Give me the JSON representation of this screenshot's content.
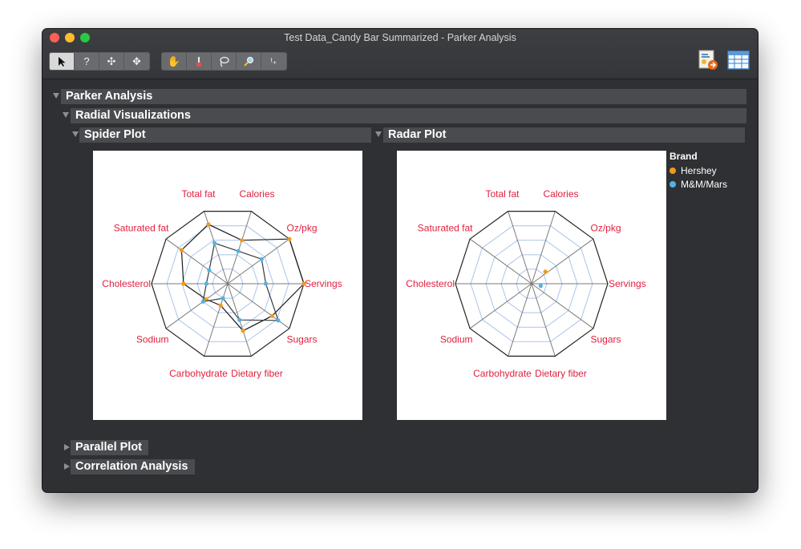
{
  "window": {
    "title": "Test Data_Candy Bar Summarized - Parker Analysis"
  },
  "toolbar": {
    "tools": [
      {
        "name": "arrow-tool",
        "icon": "arrow-icon",
        "glyph": ""
      },
      {
        "name": "help-tool",
        "icon": "question-icon",
        "glyph": "?"
      },
      {
        "name": "selection-tool",
        "icon": "crosshair-icon",
        "glyph": "✣"
      },
      {
        "name": "scroller-tool",
        "icon": "move-icon",
        "glyph": "✥"
      },
      {
        "name": "grabber-tool",
        "icon": "hand-icon",
        "glyph": "✋"
      },
      {
        "name": "brush-tool",
        "icon": "brush-icon",
        "glyph": "♜"
      },
      {
        "name": "lasso-tool",
        "icon": "lasso-icon",
        "glyph": "ρ"
      },
      {
        "name": "magnifier-tool",
        "icon": "magnifier-icon",
        "glyph": "⚲"
      },
      {
        "name": "annotate-tool",
        "icon": "annotate-icon",
        "glyph": "ᵗ₊"
      }
    ]
  },
  "outline": {
    "parker_analysis": "Parker Analysis",
    "radial_visualizations": "Radial Visualizations",
    "spider_plot": "Spider Plot",
    "radar_plot": "Radar Plot",
    "parallel_plot": "Parallel Plot",
    "correlation_analysis": "Correlation Analysis"
  },
  "legend": {
    "title": "Brand",
    "items": [
      {
        "label": "Hershey",
        "color": "#f29a19"
      },
      {
        "label": "M&M/Mars",
        "color": "#52b2e5"
      }
    ]
  },
  "colors": {
    "axis_label": "#e0203e",
    "grid": "#aac4ea",
    "hershey": "#f29a19",
    "mm_mars": "#52b2e5"
  },
  "chart_data": [
    {
      "type": "radar",
      "title": "Spider Plot",
      "axes": [
        "Calories",
        "Oz/pkg",
        "Servings",
        "Sugars",
        "Dietary fiber",
        "Carbohydrate",
        "Sodium",
        "Cholesterol",
        "Saturated fat",
        "Total fat"
      ],
      "series": [
        {
          "name": "Hershey",
          "values": [
            0.6,
            1.0,
            1.0,
            0.72,
            0.65,
            0.3,
            0.35,
            0.58,
            0.75,
            0.82
          ]
        },
        {
          "name": "M&M/Mars",
          "values": [
            0.45,
            0.55,
            0.5,
            0.82,
            0.5,
            0.2,
            0.4,
            0.28,
            0.3,
            0.56
          ]
        }
      ]
    },
    {
      "type": "radar",
      "title": "Radar Plot",
      "axes": [
        "Calories",
        "Oz/pkg",
        "Servings",
        "Sugars",
        "Dietary fiber",
        "Carbohydrate",
        "Sodium",
        "Cholesterol",
        "Saturated fat",
        "Total fat"
      ],
      "series": [
        {
          "name": "Hershey",
          "centroid": [
            0.18,
            0.16
          ]
        },
        {
          "name": "M&M/Mars",
          "centroid": [
            0.12,
            -0.03
          ]
        }
      ]
    }
  ]
}
